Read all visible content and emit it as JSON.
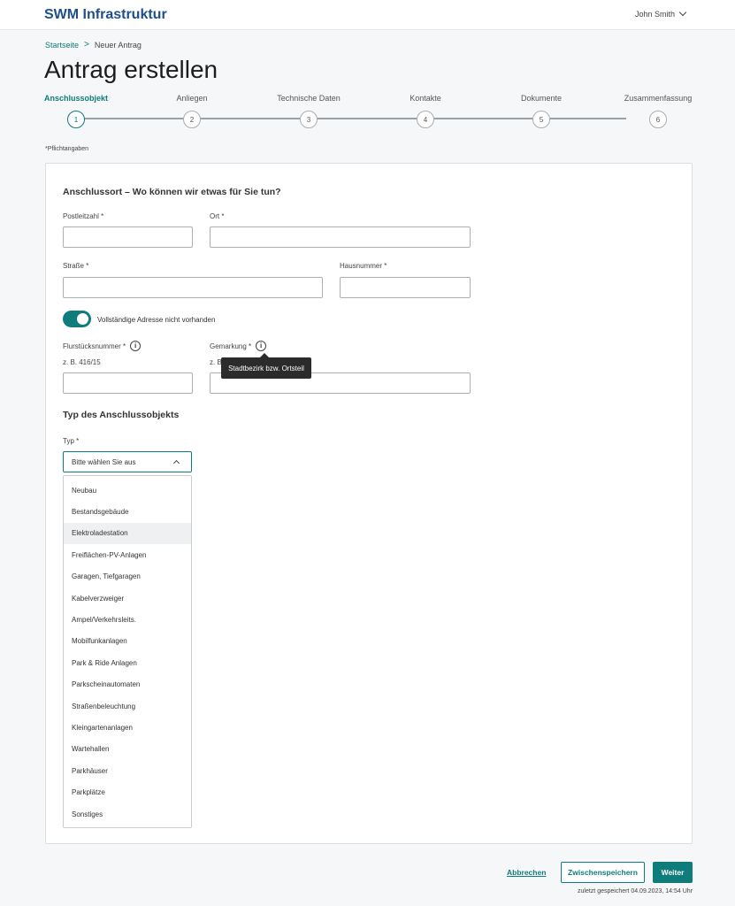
{
  "header": {
    "brand": "SWM Infrastruktur",
    "user_name": "John Smith"
  },
  "breadcrumb": {
    "home": "Startseite",
    "separator": ">",
    "current": "Neuer Antrag"
  },
  "page_title": "Antrag erstellen",
  "stepper": {
    "active_index": 0,
    "steps": [
      {
        "label": "Anschlussobjekt",
        "number": "1"
      },
      {
        "label": "Anliegen",
        "number": "2"
      },
      {
        "label": "Technische Daten",
        "number": "3"
      },
      {
        "label": "Kontakte",
        "number": "4"
      },
      {
        "label": "Dokumente",
        "number": "5"
      },
      {
        "label": "Zusammenfassung",
        "number": "6"
      }
    ]
  },
  "required_note": "*Pflichtangaben",
  "form": {
    "section1_title": "Anschlussort – Wo können wir etwas für Sie tun?",
    "postleitzahl_label": "Postleitzahl *",
    "ort_label": "Ort *",
    "strasse_label": "Straße *",
    "hausnummer_label": "Hausnummer *",
    "toggle_label": "Vollständige Adresse nicht vorhanden",
    "toggle_on": true,
    "flurstueck_label": "Flurstücksnummer *",
    "flurstueck_hint": "z. B. 416/15",
    "gemarkung_label": "Gemarkung *",
    "gemarkung_hint": "z. B.",
    "tooltip": "Stadtbezirk bzw. Ortsteil",
    "section2_title": "Typ des Anschlussobjekts",
    "typ_label": "Typ *",
    "typ_placeholder": "Bitte wählen Sie aus",
    "typ_options": [
      "Neubau",
      "Bestandsgebäude",
      "Elektroladestation",
      "Freiflächen-PV-Anlagen",
      "Garagen, Tiefgaragen",
      "Kabelverzweiger",
      "Ampel/Verkehrsleits.",
      "Mobilfunkanlagen",
      "Park & Ride Anlagen",
      "Parkscheinautomaten",
      "Straßenbeleuchtung",
      "Kleingartenanlagen",
      "Wartehallen",
      "Parkhäuser",
      "Parkplätze",
      "Sonstiges"
    ],
    "hovered_option_index": 2
  },
  "icons": {
    "info": "info-icon",
    "user_menu": "chevron-down-icon",
    "select": "chevron-up-icon"
  },
  "colors": {
    "accent": "#0e7c7b",
    "brand": "#1f4e8c"
  },
  "actions": {
    "cancel": "Abbrechen",
    "save_draft": "Zwischenspeichern",
    "next": "Weiter",
    "saved_note": "zuletzt gespeichert 04.09.2023, 14:54 Uhr"
  }
}
